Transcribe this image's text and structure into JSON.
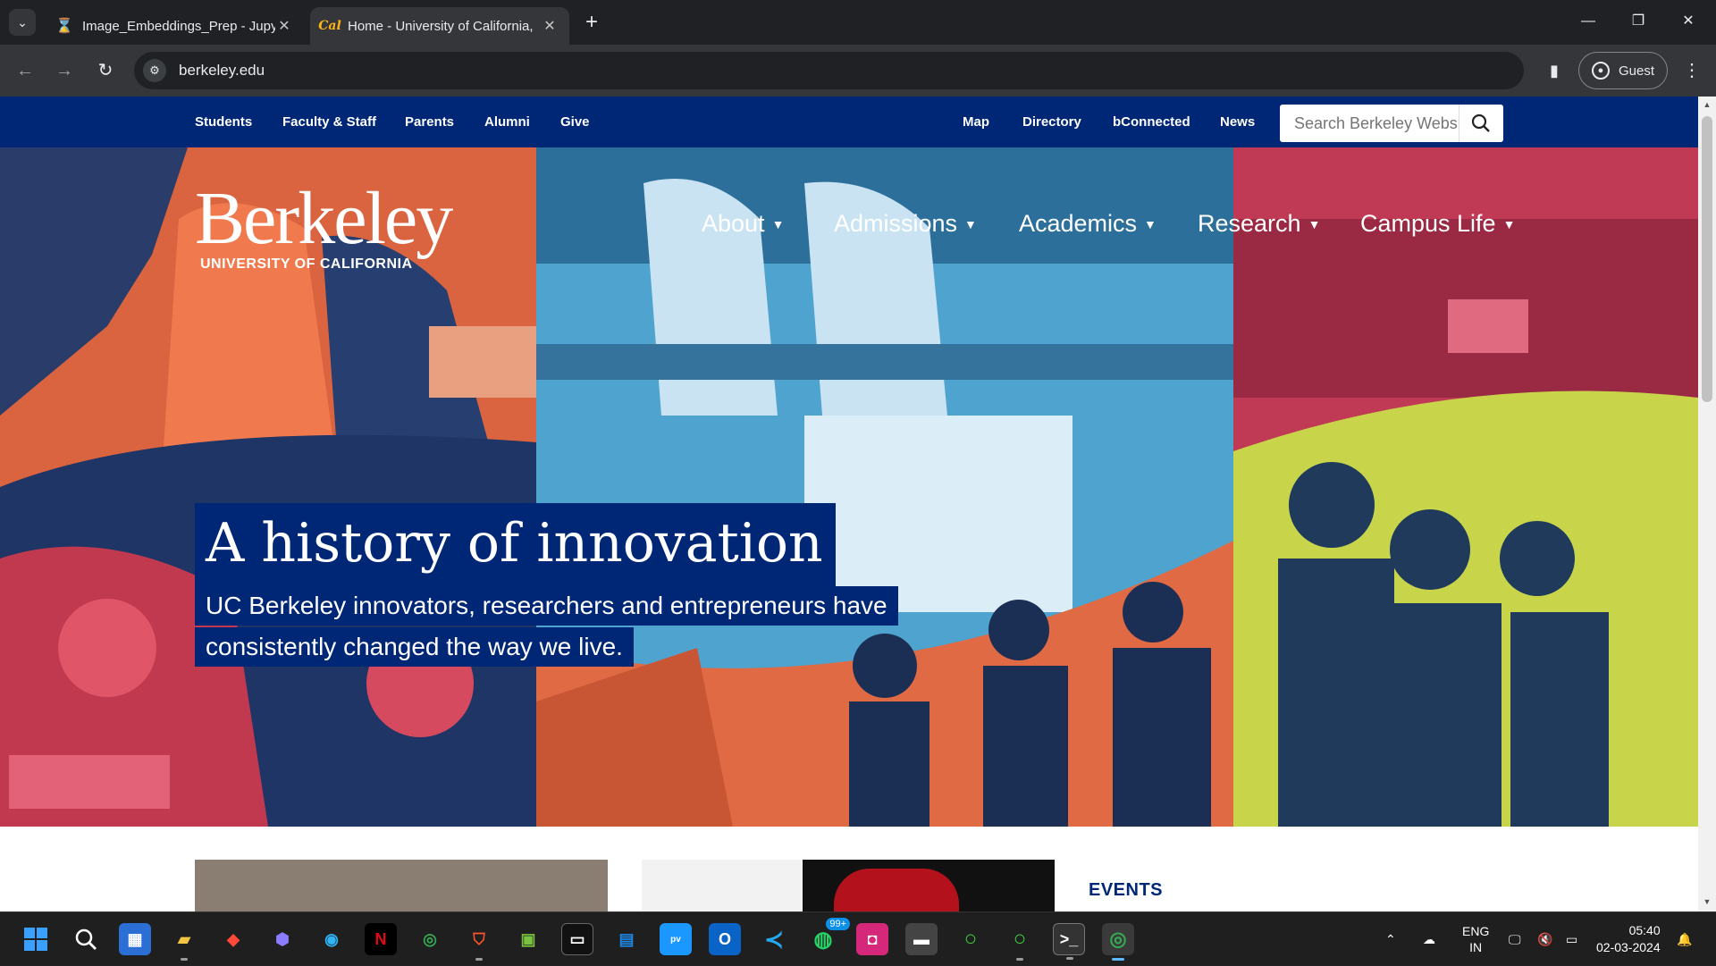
{
  "browser": {
    "tabs": [
      {
        "title": "Image_Embeddings_Prep - Jupy",
        "favicon": "hourglass-icon",
        "active": false
      },
      {
        "title": "Home - University of California,",
        "favicon": "cal-icon",
        "active": true
      }
    ],
    "url": "berkeley.edu",
    "profile_label": "Guest"
  },
  "site": {
    "utility_left": [
      "Students",
      "Faculty & Staff",
      "Parents",
      "Alumni",
      "Give"
    ],
    "utility_right": [
      "Map",
      "Directory",
      "bConnected",
      "News"
    ],
    "search_placeholder": "Search Berkeley Website",
    "logo_word": "Berkeley",
    "logo_sub": "UNIVERSITY OF CALIFORNIA",
    "main_nav": [
      "About",
      "Admissions",
      "Academics",
      "Research",
      "Campus Life"
    ],
    "hero_title": "A history of innovation",
    "hero_subtitle_line1": "UC Berkeley innovators, researchers and entrepreneurs have",
    "hero_subtitle_line2": "consistently changed the way we live.",
    "events_heading": "EVENTS"
  },
  "taskbar": {
    "language_line1": "ENG",
    "language_line2": "IN",
    "time": "05:40",
    "date": "02-03-2024",
    "whatsapp_badge": "99+"
  },
  "colors": {
    "berkeley_blue": "#002676",
    "hero_orange": "#e06a44",
    "hero_sky": "#4ea3cf",
    "hero_lime": "#c8d44a",
    "hero_rose": "#c03a55"
  }
}
